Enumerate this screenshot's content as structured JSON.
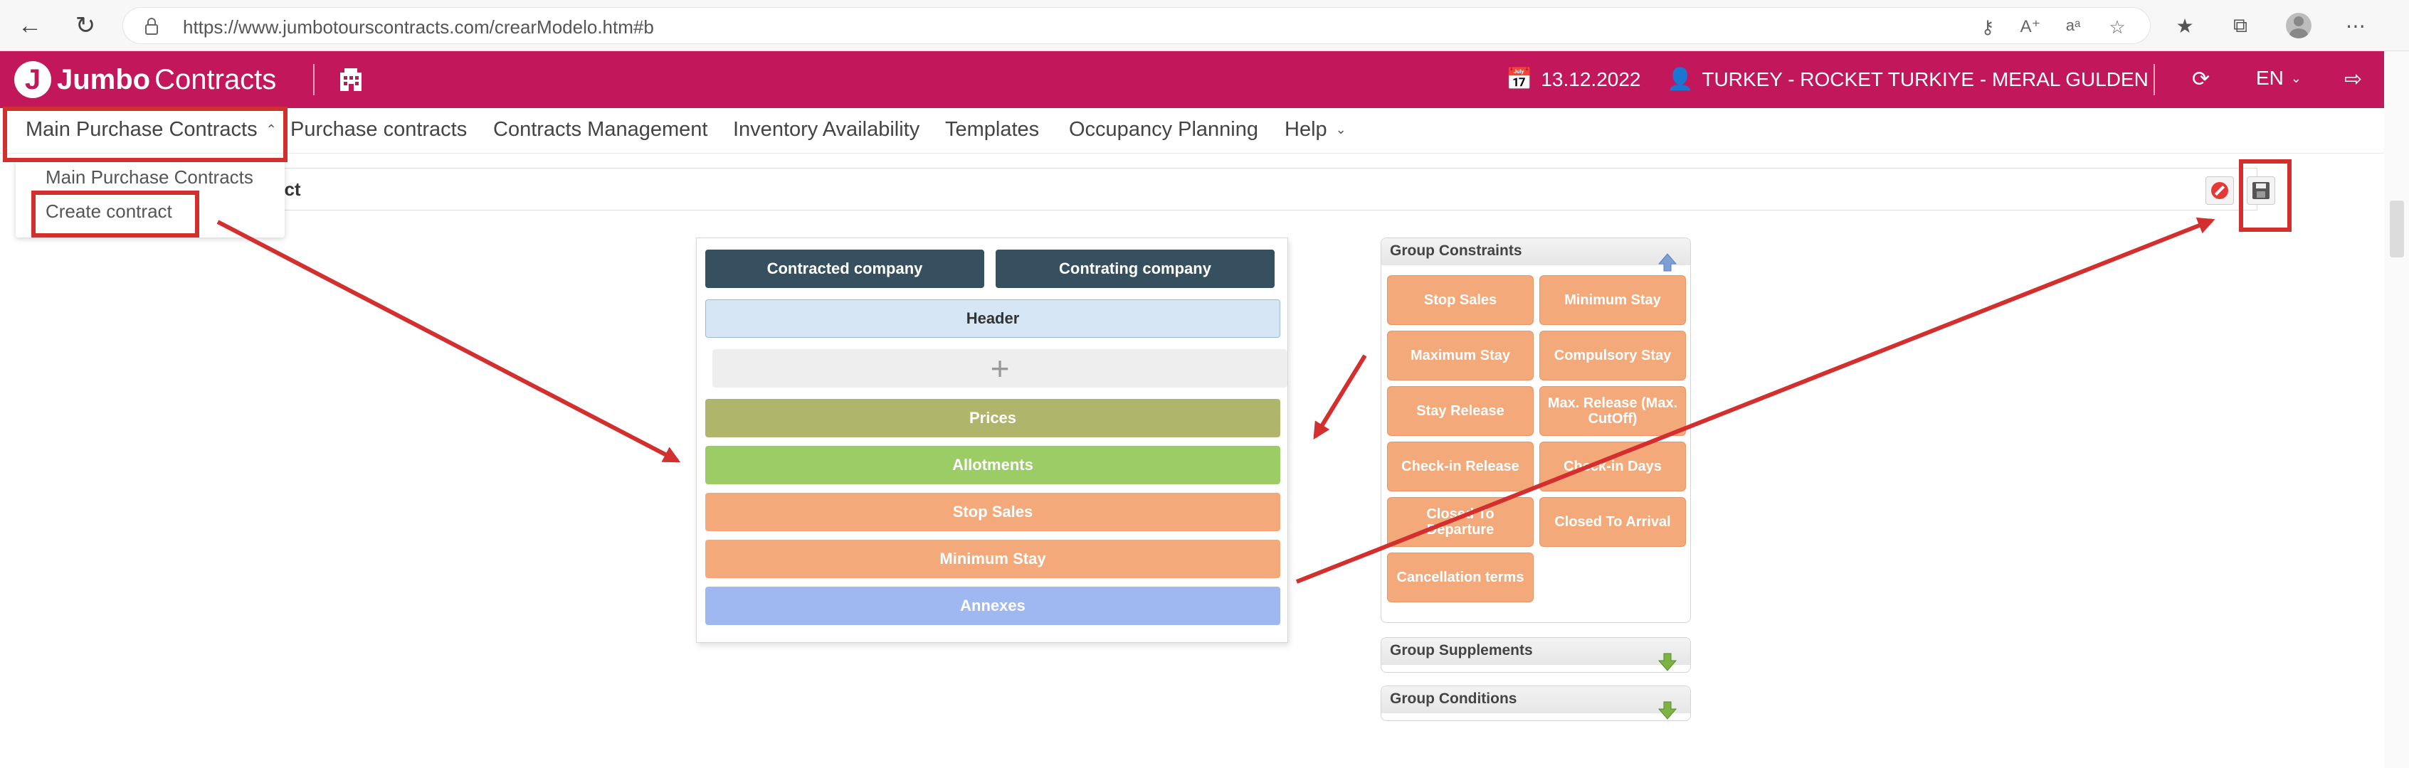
{
  "browser": {
    "url": "https://www.jumbotourscontracts.com/crearModelo.htm#b"
  },
  "header": {
    "logo_jumbo": "Jumbo",
    "logo_contracts": "Contracts",
    "date": "13.12.2022",
    "user": "TURKEY - ROCKET TURKIYE - MERAL GULDEN",
    "language": "EN"
  },
  "menu": {
    "items": [
      {
        "label": "Main Purchase Contracts"
      },
      {
        "label": "Purchase contracts"
      },
      {
        "label": "Contracts Management"
      },
      {
        "label": "Inventory Availability"
      },
      {
        "label": "Templates"
      },
      {
        "label": "Occupancy Planning"
      },
      {
        "label": "Help"
      }
    ],
    "dropdown": [
      "Main Purchase Contracts",
      "Create contract"
    ]
  },
  "page": {
    "title_fragment": "act"
  },
  "model": {
    "contracted_company": "Contracted company",
    "contrating_company": "Contrating company",
    "header": "Header",
    "add_symbol": "+",
    "sections": [
      "Prices",
      "Allotments",
      "Stop Sales",
      "Minimum Stay",
      "Annexes"
    ]
  },
  "group_constraints": {
    "title": "Group Constraints",
    "buttons": [
      "Stop Sales",
      "Minimum Stay",
      "Maximum Stay",
      "Compulsory Stay",
      "Stay Release",
      "Max. Release (Max. CutOff)",
      "Check-in Release",
      "Check-in Days",
      "Closed To Departure",
      "Closed To Arrival",
      "Cancellation terms"
    ]
  },
  "group_supplements": {
    "title": "Group Supplements"
  },
  "group_conditions": {
    "title": "Group Conditions"
  },
  "colors": {
    "brand": "#c2185b",
    "dark_button": "#37505f",
    "prices": "#afb56a",
    "allotments": "#9ccc65",
    "constraint": "#f4a97a",
    "annexes": "#9fb8f2",
    "annotation": "#d32f2f"
  }
}
